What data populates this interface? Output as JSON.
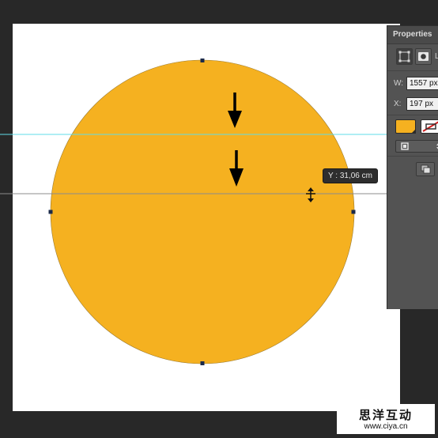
{
  "canvas": {
    "shape_fill_color": "#f5b120",
    "guide_color": "#5fdde8",
    "drag_guide_color": "#8c8c8c"
  },
  "tooltip": {
    "text": "Y : 31,06 cm"
  },
  "properties_panel": {
    "tab_label": "Properties",
    "w_label": "W:",
    "w_value": "1557 px",
    "x_label": "X:",
    "x_value": "197 px",
    "fill_color": "#f5b120",
    "stroke_color": "#ffffff"
  },
  "watermark": {
    "main": "思洋互动",
    "sub": "www.ciya.cn"
  }
}
